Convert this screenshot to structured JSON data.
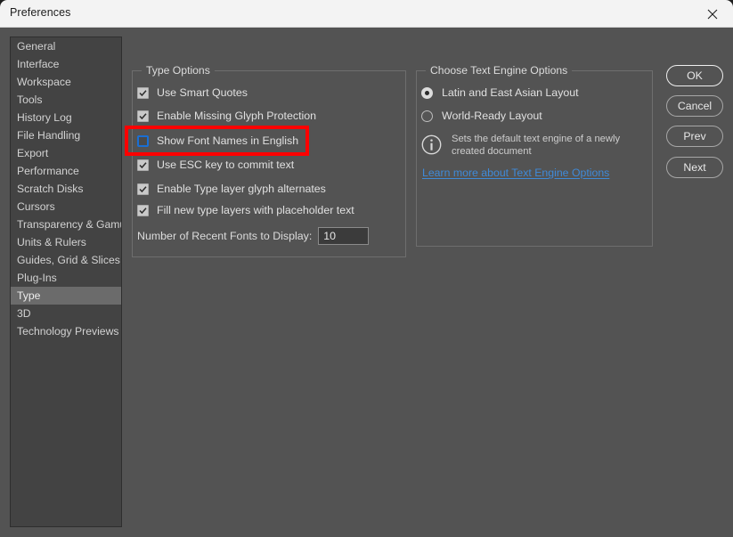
{
  "window": {
    "title": "Preferences",
    "close_icon": "close-icon"
  },
  "sidebar": {
    "items": [
      {
        "label": "General",
        "selected": false
      },
      {
        "label": "Interface",
        "selected": false
      },
      {
        "label": "Workspace",
        "selected": false
      },
      {
        "label": "Tools",
        "selected": false
      },
      {
        "label": "History Log",
        "selected": false
      },
      {
        "label": "File Handling",
        "selected": false
      },
      {
        "label": "Export",
        "selected": false
      },
      {
        "label": "Performance",
        "selected": false
      },
      {
        "label": "Scratch Disks",
        "selected": false
      },
      {
        "label": "Cursors",
        "selected": false
      },
      {
        "label": "Transparency & Gamut",
        "selected": false
      },
      {
        "label": "Units & Rulers",
        "selected": false
      },
      {
        "label": "Guides, Grid & Slices",
        "selected": false
      },
      {
        "label": "Plug-Ins",
        "selected": false
      },
      {
        "label": "Type",
        "selected": true
      },
      {
        "label": "3D",
        "selected": false
      },
      {
        "label": "Technology Previews",
        "selected": false
      }
    ]
  },
  "type_options": {
    "title": "Type Options",
    "checkboxes": [
      {
        "label": "Use Smart Quotes",
        "checked": true
      },
      {
        "label": "Enable Missing Glyph Protection",
        "checked": true
      },
      {
        "label": "Show Font Names in English",
        "checked": false
      },
      {
        "label": "Use ESC key to commit text",
        "checked": true
      },
      {
        "label": "Enable Type layer glyph alternates",
        "checked": true
      },
      {
        "label": "Fill new type layers with placeholder text",
        "checked": true
      }
    ],
    "recent_fonts": {
      "label": "Number of Recent Fonts to Display:",
      "value": "10",
      "placeholder": "10"
    }
  },
  "text_engine_options": {
    "title": "Choose Text Engine Options",
    "radios": [
      {
        "label": "Latin and East Asian Layout",
        "selected": true
      },
      {
        "label": "World-Ready Layout",
        "selected": false
      }
    ],
    "info_icon": "info-icon",
    "info_text": "Sets the default text engine of a newly created document",
    "link_label": "Learn more about Text Engine Options"
  },
  "buttons": {
    "ok": "OK",
    "cancel": "Cancel",
    "prev": "Prev",
    "next": "Next"
  },
  "annotation": {
    "color": "#ff0000",
    "target": "Show Font Names in English"
  }
}
